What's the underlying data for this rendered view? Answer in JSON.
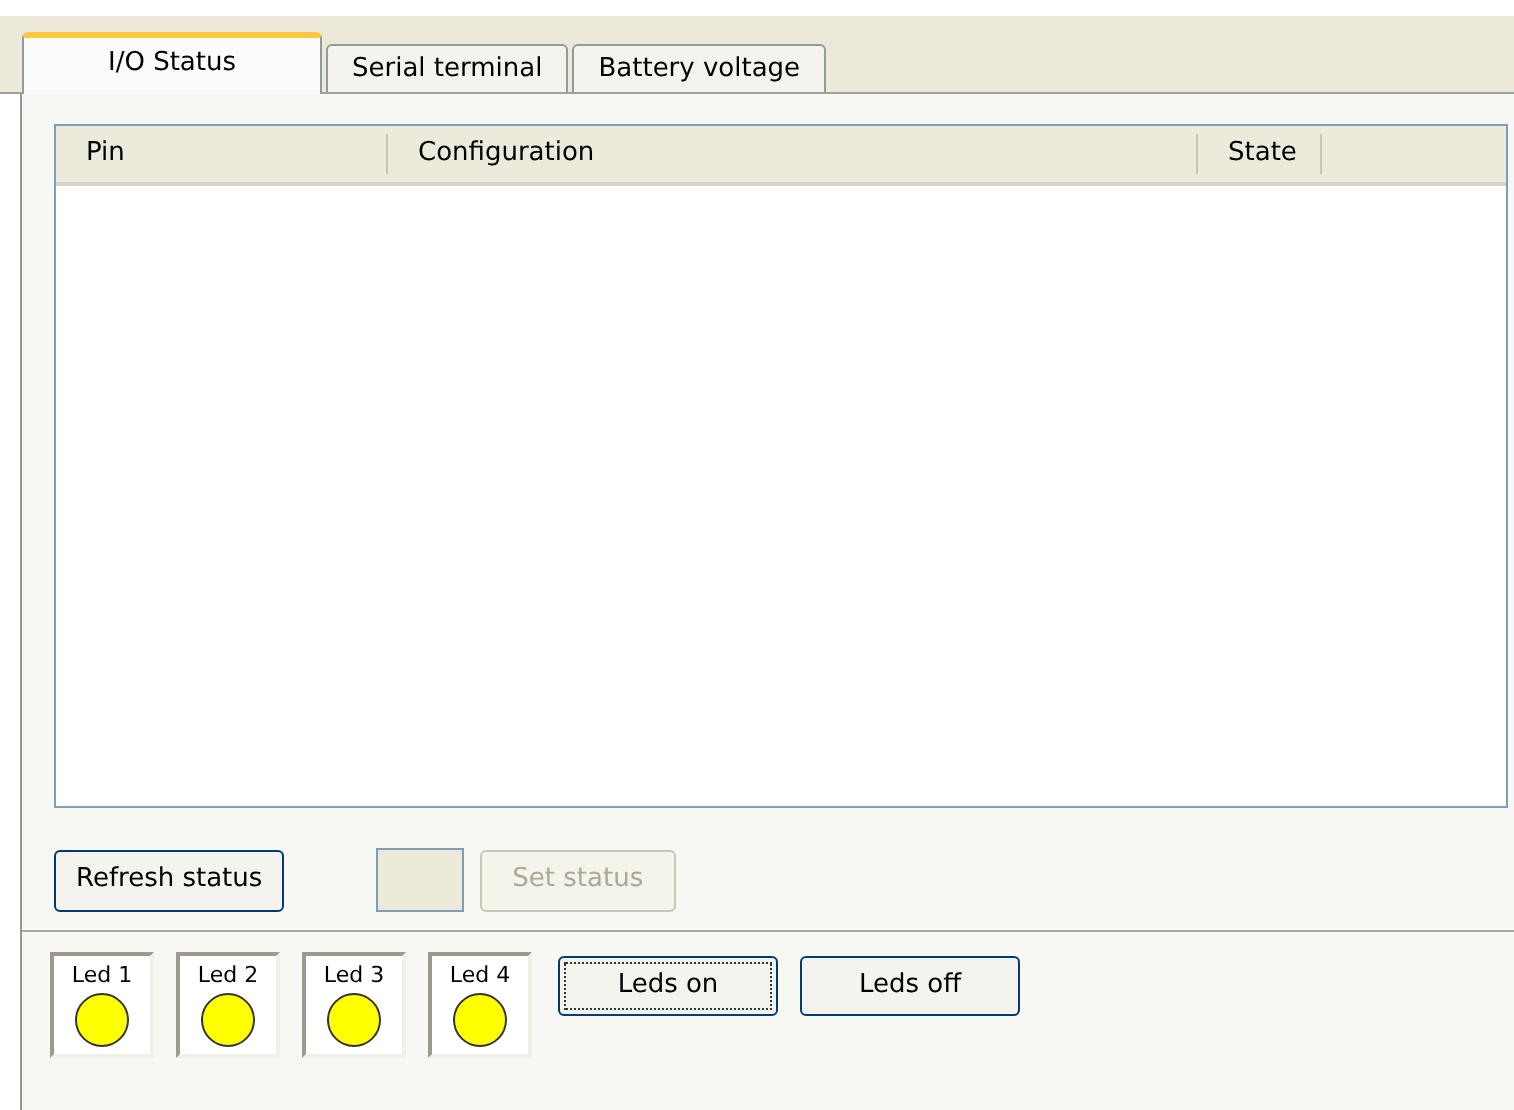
{
  "tabs": [
    {
      "label": "I/O Status",
      "selected": true
    },
    {
      "label": "Serial terminal",
      "selected": false
    },
    {
      "label": "Battery voltage",
      "selected": false
    }
  ],
  "table": {
    "columns": [
      "Pin",
      "Configuration",
      "State"
    ]
  },
  "actions": [
    {
      "label": "Refresh status",
      "disabled": false
    },
    {
      "label": "Set status",
      "disabled": true
    }
  ],
  "leds": [
    {
      "label": "Led 1",
      "lit": true
    },
    {
      "label": "Led 2",
      "lit": true
    },
    {
      "label": "Led 3",
      "lit": true
    },
    {
      "label": "Led 4",
      "lit": true
    }
  ],
  "led_buttons": [
    {
      "label": "Leds on",
      "focused": true
    },
    {
      "label": "Leds off",
      "focused": false
    }
  ]
}
